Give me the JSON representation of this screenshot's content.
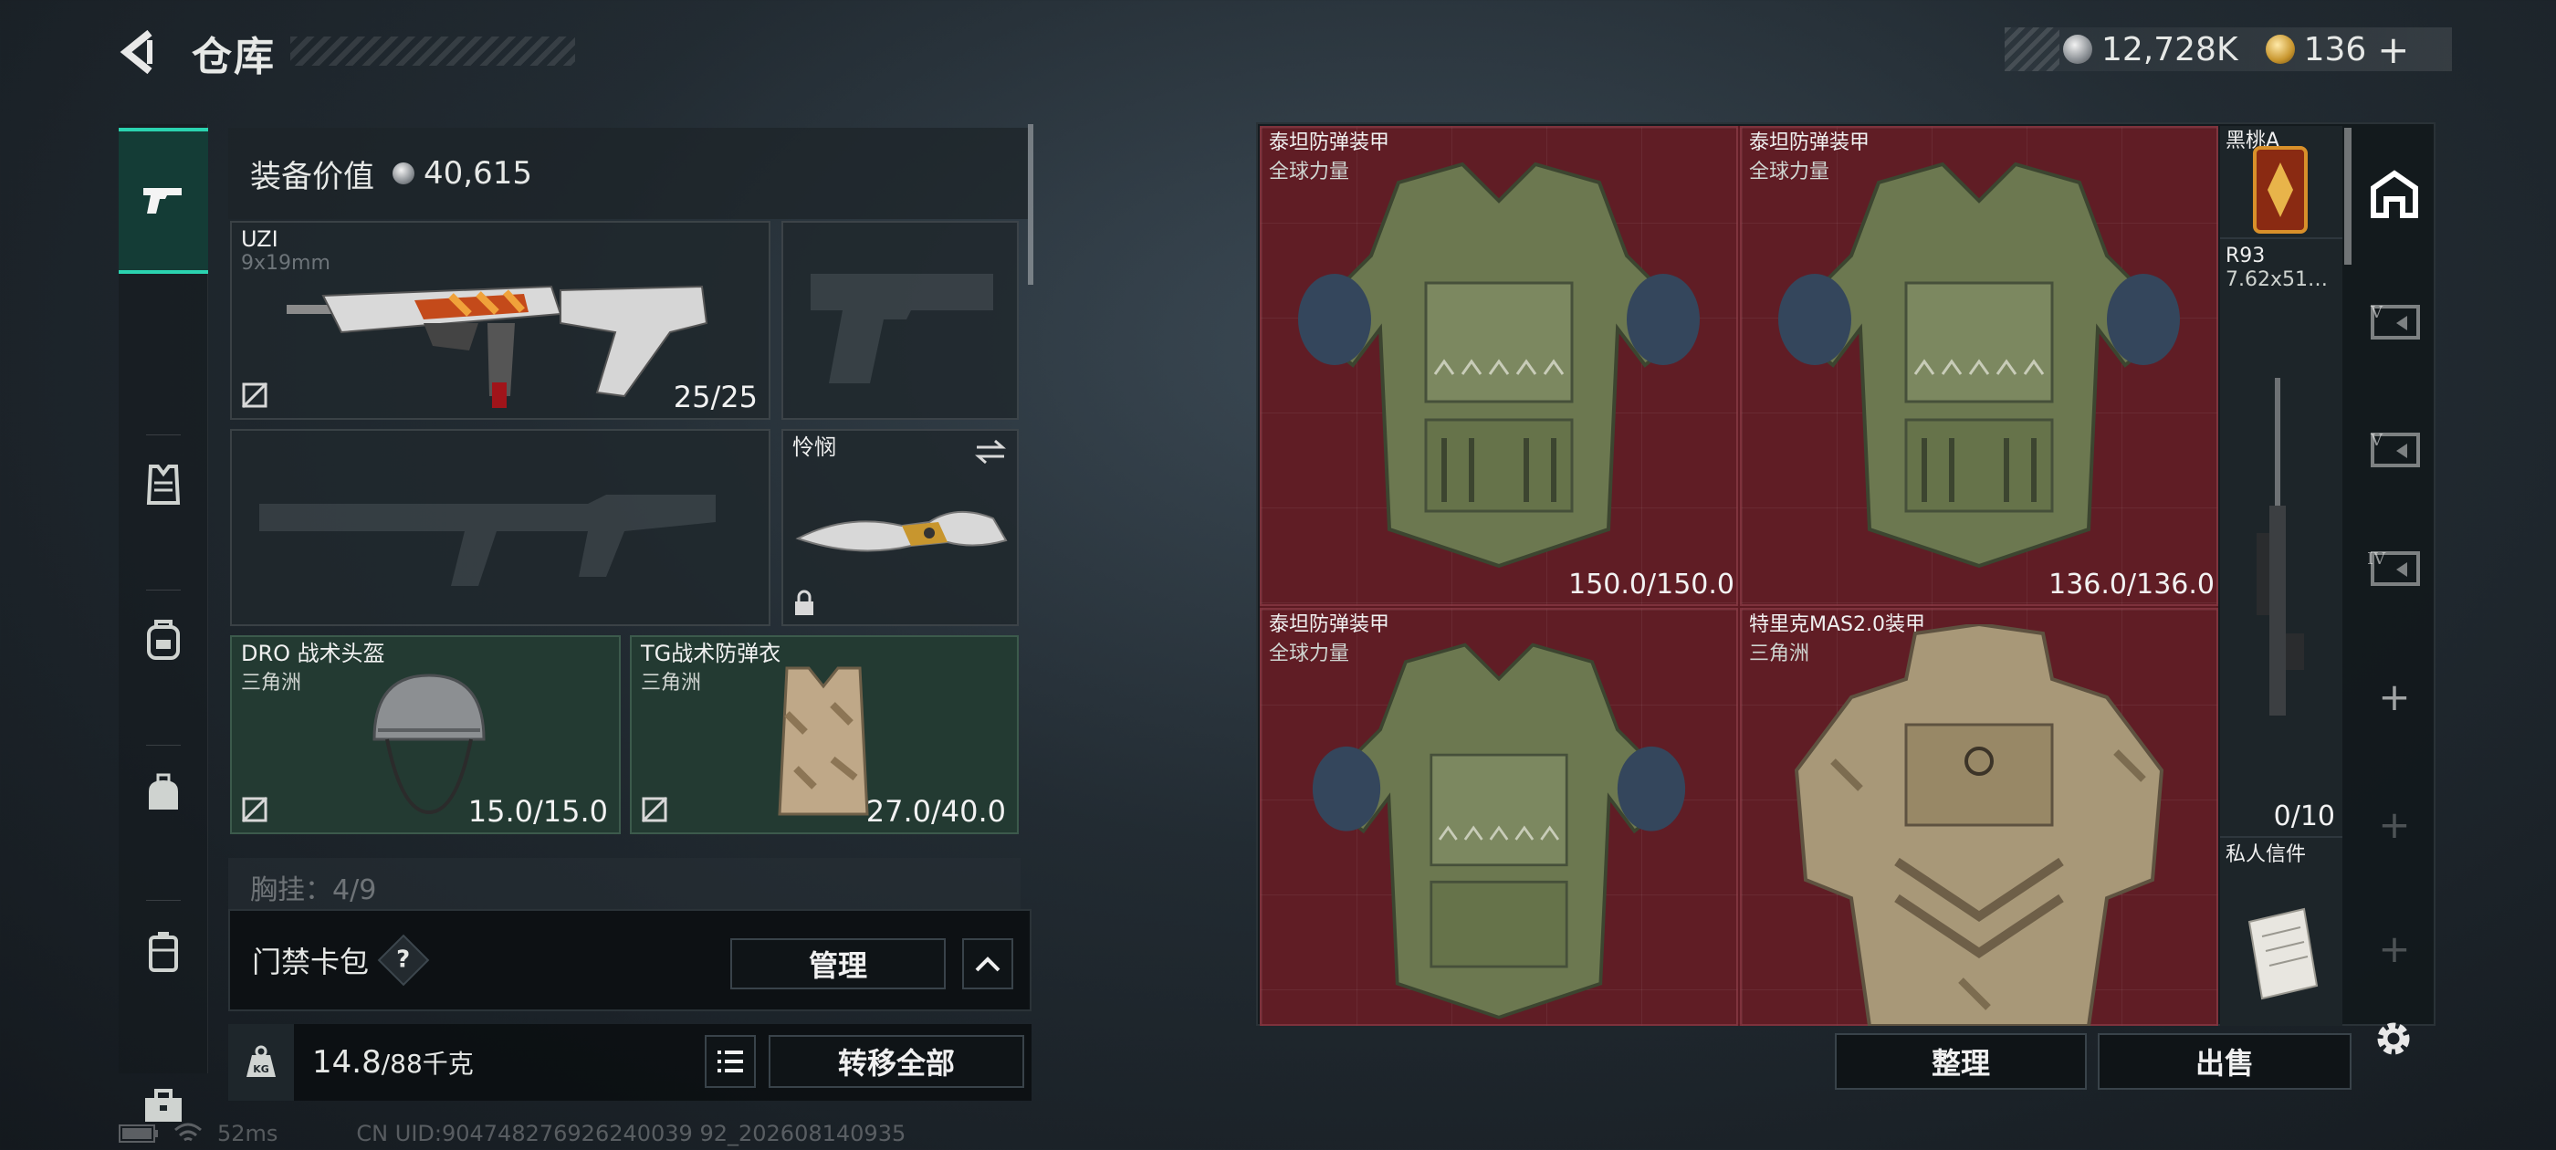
{
  "header": {
    "title": "仓库"
  },
  "currency": {
    "silver": "12,728K",
    "gold": "136",
    "gold_plus": "+"
  },
  "nav": {
    "items": [
      {
        "name": "weapons",
        "icon": "pistol-icon",
        "active": true
      },
      {
        "name": "armor",
        "icon": "vest-icon"
      },
      {
        "name": "backpack",
        "icon": "backpack-icon"
      },
      {
        "name": "rig",
        "icon": "rig-bag-icon"
      },
      {
        "name": "case",
        "icon": "case-icon"
      },
      {
        "name": "toolbox",
        "icon": "toolbox-icon"
      }
    ]
  },
  "loadout": {
    "value_label": "装备价值",
    "value": "40,615",
    "primary": {
      "name": "UZI",
      "caliber": "9x19mm",
      "durability": "25/25"
    },
    "melee": {
      "name": "怜悯"
    },
    "helmet": {
      "name": "DRO 战术头盔",
      "origin": "三角洲",
      "durability": "15.0/15.0"
    },
    "armor": {
      "name": "TG战术防弹衣",
      "origin": "三角洲",
      "durability": "27.0/40.0"
    },
    "chest_rig": "胸挂：4/9",
    "keycard": {
      "label": "门禁卡包",
      "help": "?",
      "manage": "管理"
    },
    "weight": {
      "current": "14.8",
      "max": "/88千克",
      "kg_icon": "KG"
    },
    "transfer_all": "转移全部"
  },
  "stash": {
    "items": [
      {
        "name": "泰坦防弹装甲",
        "origin": "全球力量",
        "durability": "150.0/150.0"
      },
      {
        "name": "泰坦防弹装甲",
        "origin": "全球力量",
        "durability": "136.0/136.0"
      },
      {
        "name": "泰坦防弹装甲",
        "origin": "全球力量",
        "durability": ""
      },
      {
        "name": "特里克MAS2.0装甲",
        "origin": "三角洲",
        "durability": ""
      }
    ],
    "side": [
      {
        "name": "黑桃A"
      },
      {
        "name": "R93",
        "sub": "7.62x51…",
        "count": "0/10"
      },
      {
        "name": "私人信件"
      }
    ],
    "organize": "整理",
    "sell": "出售",
    "tabs": [
      "home-icon",
      "V",
      "V",
      "IV"
    ]
  },
  "status": {
    "ping": "52ms",
    "uid": "CN UID:904748276926240039 92_202608140935"
  },
  "colors": {
    "accent": "#2bd3b0",
    "stash_bg": "#5c1a22",
    "slot_green": "#233a32"
  }
}
